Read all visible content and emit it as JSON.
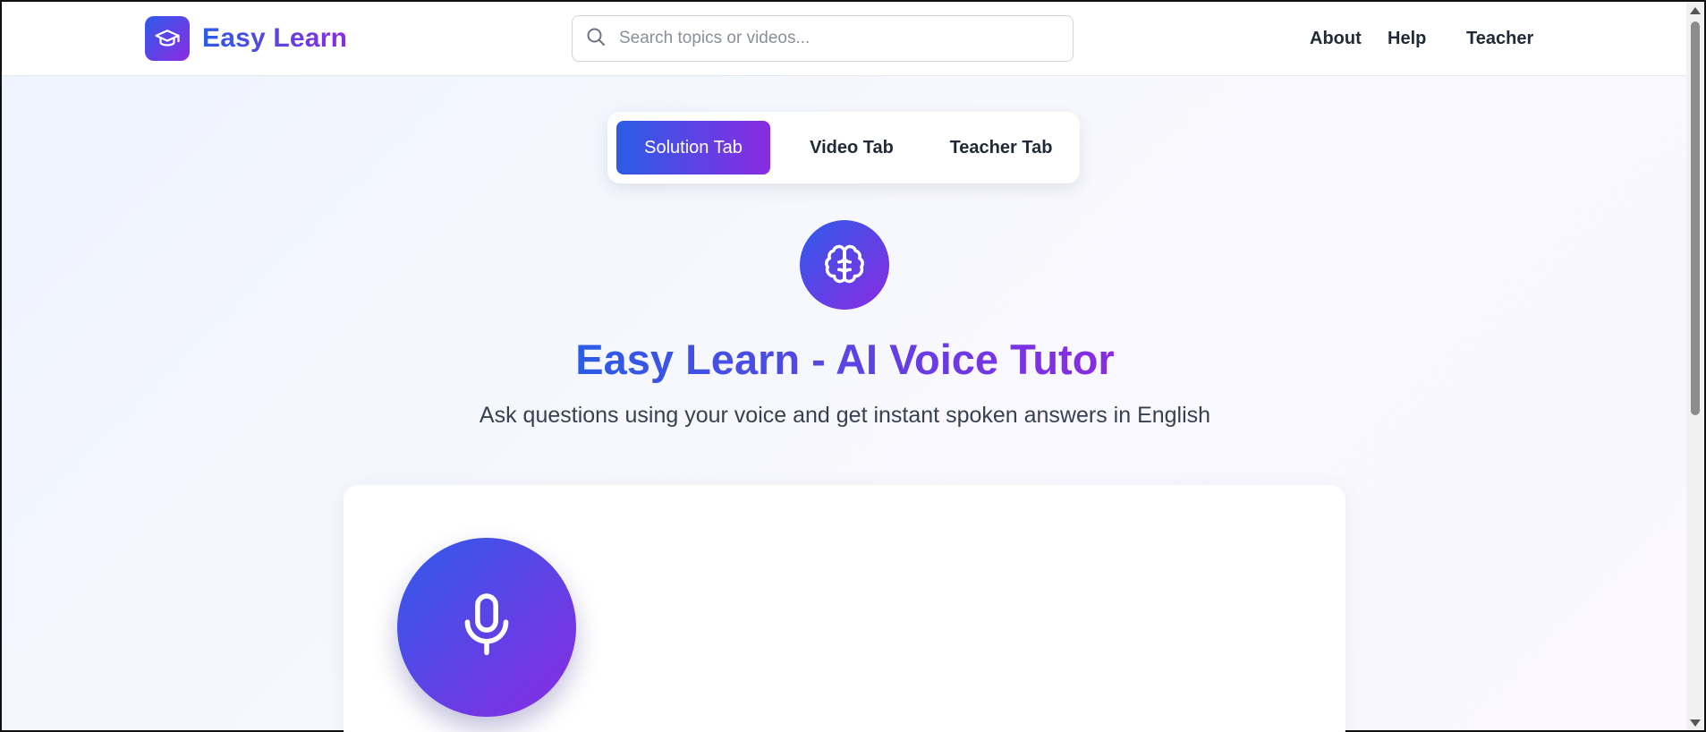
{
  "header": {
    "brand": "Easy Learn",
    "brand_icon": "graduation-cap-icon",
    "search": {
      "placeholder": "Search topics or videos...",
      "value": "",
      "icon": "search-icon"
    },
    "nav": {
      "about": "About",
      "help": "Help",
      "teacher": "Teacher"
    }
  },
  "tabs": [
    {
      "label": "Solution Tab",
      "active": true
    },
    {
      "label": "Video Tab",
      "active": false
    },
    {
      "label": "Teacher Tab",
      "active": false
    }
  ],
  "hero": {
    "icon": "brain-icon",
    "title": "Easy Learn - AI Voice Tutor",
    "subtitle": "Ask questions using your voice and get instant spoken answers in English"
  },
  "voice": {
    "icon": "microphone-icon"
  },
  "colors": {
    "gradient_start": "#2b5ce6",
    "gradient_end": "#8a2be2",
    "text_dark": "#1f2937",
    "text_muted": "#374151"
  }
}
